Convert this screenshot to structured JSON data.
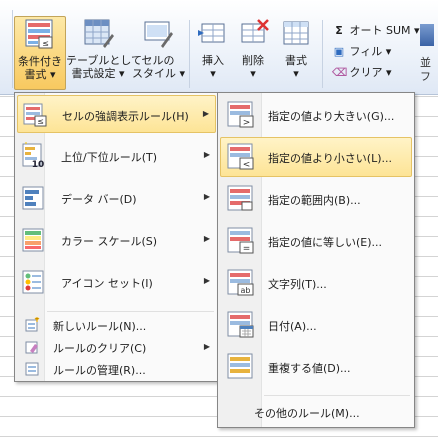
{
  "ribbon": {
    "conditional": {
      "label1": "条件付き",
      "label2": "書式"
    },
    "table": {
      "label1": "テーブルとして",
      "label2": "書式設定"
    },
    "cellstyle": {
      "label1": "セルの",
      "label2": "スタイル"
    },
    "insert": {
      "label": "挿入"
    },
    "delete": {
      "label": "削除"
    },
    "format": {
      "label": "書式"
    },
    "autosum": "オート SUM",
    "fill": "フィル",
    "clear": "クリア",
    "right_fragment1": "並",
    "right_fragment2": "フ"
  },
  "left_menu": {
    "items": [
      {
        "label": "セルの強調表示ルール(H)"
      },
      {
        "label": "上位/下位ルール(T)"
      },
      {
        "label": "データ バー(D)"
      },
      {
        "label": "カラー スケール(S)"
      },
      {
        "label": "アイコン セット(I)"
      },
      {
        "label": "新しいルール(N)..."
      },
      {
        "label": "ルールのクリア(C)"
      },
      {
        "label": "ルールの管理(R)..."
      }
    ]
  },
  "right_menu": {
    "items": [
      {
        "label": "指定の値より大きい(G)..."
      },
      {
        "label": "指定の値より小さい(L)..."
      },
      {
        "label": "指定の範囲内(B)..."
      },
      {
        "label": "指定の値に等しい(E)..."
      },
      {
        "label": "文字列(T)..."
      },
      {
        "label": "日付(A)..."
      },
      {
        "label": "重複する値(D)..."
      },
      {
        "label": "その他のルール(M)..."
      }
    ]
  },
  "icons": {
    "greater": ">",
    "less": "<",
    "text": "ab",
    "top10": "10"
  },
  "colors": {
    "highlight_bg": "#fde496",
    "highlight_border": "#e5c365",
    "ribbon_active": "#f8c960",
    "menu_border": "#868686"
  }
}
